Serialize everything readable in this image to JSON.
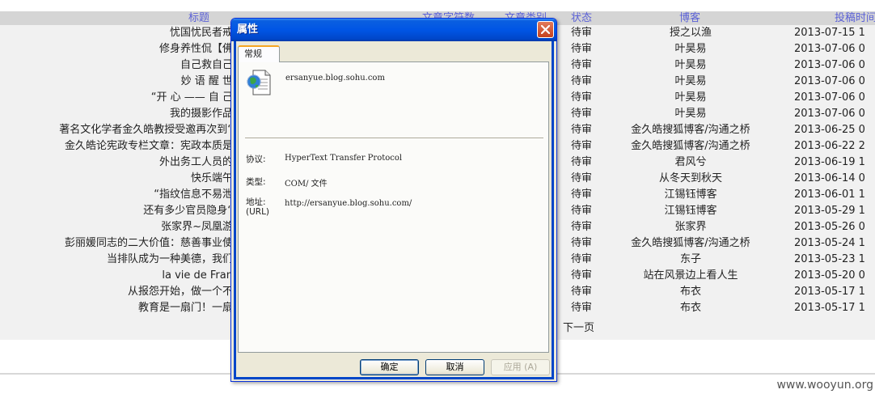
{
  "table": {
    "headers": {
      "title": "标题",
      "chars": "文章字符数",
      "category": "文章类别",
      "status": "状态",
      "blogger": "博客",
      "time": "投稿时间"
    },
    "rows": [
      {
        "title": "忧国忧民者戒",
        "status": "待审",
        "blogger": "授之以渔",
        "time": "2013-07-15 1"
      },
      {
        "title": "修身养性侃【佛",
        "status": "待审",
        "blogger": "叶昊易",
        "time": "2013-07-06 0"
      },
      {
        "title": "自己救自己",
        "status": "待审",
        "blogger": "叶昊易",
        "time": "2013-07-06 0"
      },
      {
        "title": "妙 语 醒 世",
        "status": "待审",
        "blogger": "叶昊易",
        "time": "2013-07-06 0"
      },
      {
        "title": "“开 心 —— 自 己",
        "status": "待审",
        "blogger": "叶昊易",
        "time": "2013-07-06 0"
      },
      {
        "title": "我的摄影作品",
        "status": "待审",
        "blogger": "叶昊易",
        "time": "2013-07-06 0"
      },
      {
        "title": "著名文化学者金久皓教授受邀再次到“",
        "status": "待审",
        "blogger": "金久皓搜狐博客/沟通之桥",
        "time": "2013-06-25 0"
      },
      {
        "title": "金久皓论宪政专栏文章：宪政本质是",
        "status": "待审",
        "blogger": "金久皓搜狐博客/沟通之桥",
        "time": "2013-06-22 2"
      },
      {
        "title": "外出务工人员的",
        "status": "待审",
        "blogger": "君风兮",
        "time": "2013-06-19 1"
      },
      {
        "title": "快乐端午",
        "status": "待审",
        "blogger": "从冬天到秋天",
        "time": "2013-06-14 0"
      },
      {
        "title": "“指纹信息不易泄",
        "status": "待审",
        "blogger": "江锡钰博客",
        "time": "2013-06-01 1"
      },
      {
        "title": "还有多少官员隐身“",
        "status": "待审",
        "blogger": "江锡钰博客",
        "time": "2013-05-29 1"
      },
      {
        "title": "张家界~凤凰游",
        "status": "待审",
        "blogger": "张家界",
        "time": "2013-05-26 0"
      },
      {
        "title": "彭丽媛同志的二大价值：慈善事业使",
        "status": "待审",
        "blogger": "金久皓搜狐博客/沟通之桥",
        "time": "2013-05-24 1"
      },
      {
        "title": "当排队成为一种美德，我们",
        "status": "待审",
        "blogger": "东子",
        "time": "2013-05-23 1"
      },
      {
        "title": "la vie de Fran",
        "status": "待审",
        "blogger": "站在风景边上看人生",
        "time": "2013-05-20 0"
      },
      {
        "title": "从报怨开始，做一个不",
        "status": "待审",
        "blogger": "布衣",
        "time": "2013-05-17 1"
      },
      {
        "title": "教育是一扇门！一扇",
        "status": "待审",
        "blogger": "布衣",
        "time": "2013-05-17 1"
      }
    ],
    "next_page": "下一页"
  },
  "watermark": "www.wooyun.org",
  "dialog": {
    "title": "属性",
    "tab": "常规",
    "file_name": "ersanyue.blog.sohu.com",
    "protocol_label": "协议:",
    "protocol_value": "HyperText Transfer Protocol",
    "type_label": "类型:",
    "type_value": "COM/ 文件",
    "address_label": "地址:",
    "address_label_2": "(URL)",
    "address_value": "http://ersanyue.blog.sohu.com/",
    "ok_label": "确定",
    "cancel_label": "取消",
    "apply_label": "应用 (A)",
    "icons": {
      "close": "close-icon",
      "file": "web-document-icon"
    }
  }
}
